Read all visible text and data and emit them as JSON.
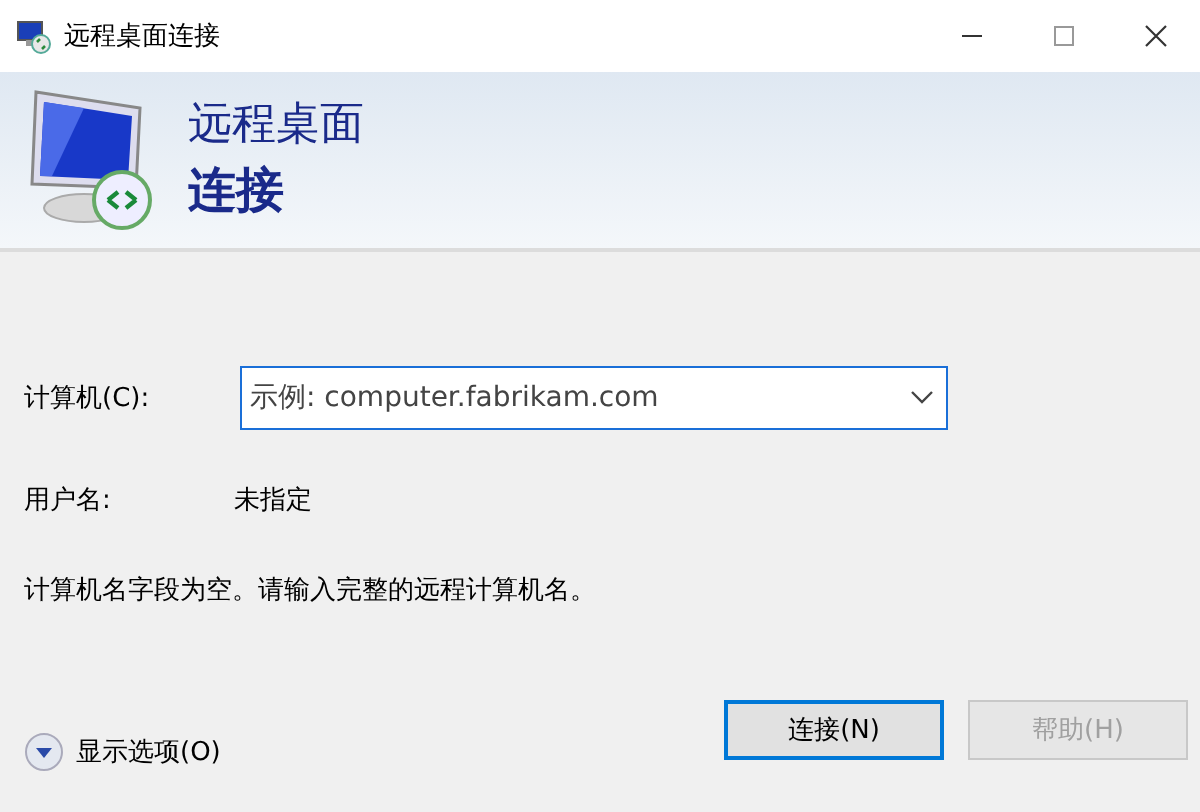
{
  "window": {
    "title": "远程桌面连接"
  },
  "banner": {
    "line_1": "远程桌面",
    "line_2": "连接"
  },
  "computer_field": {
    "label": "计算机(C):",
    "placeholder": "示例: computer.fabrikam.com"
  },
  "username": {
    "label": "用户名:",
    "value": "未指定"
  },
  "message": "计算机名字段为空。请输入完整的远程计算机名。",
  "options_toggle": {
    "label": "显示选项(O)",
    "expanded": false
  },
  "buttons": [
    {
      "label": "连接(N)",
      "kind": "default",
      "disabled": false
    },
    {
      "label": "帮助(H)",
      "kind": "normal",
      "disabled": true
    }
  ]
}
